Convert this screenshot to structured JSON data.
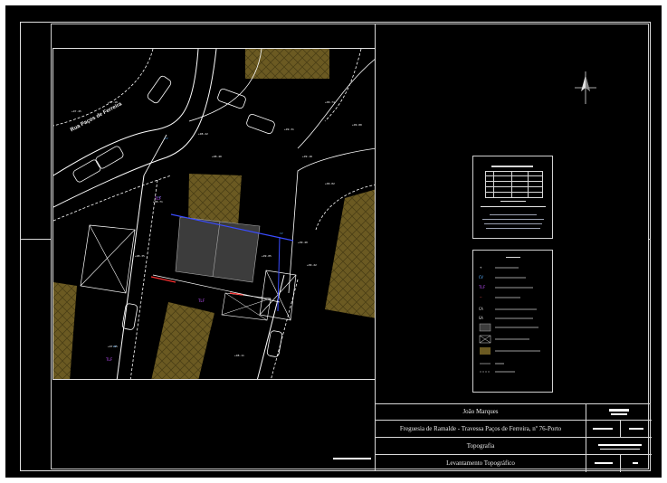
{
  "title_block": {
    "client": "João Marques",
    "location": "Freguesia de Ramalde - Travessa Paços de Ferreira, nº 76-Porto",
    "discipline": "Topografia",
    "drawing_title": "Levantamento Topográfico"
  },
  "map": {
    "street_label": "Rua Paços de Ferreira"
  },
  "colors": {
    "background": "#000000",
    "linework": "#ffffff",
    "building_fill": "#6b5a22",
    "existing_building": "#3c3c3c",
    "boundary_blue": "#3a4cff",
    "boundary_red": "#ff3030"
  },
  "icons": {
    "north_arrow": "north-arrow-icon"
  }
}
